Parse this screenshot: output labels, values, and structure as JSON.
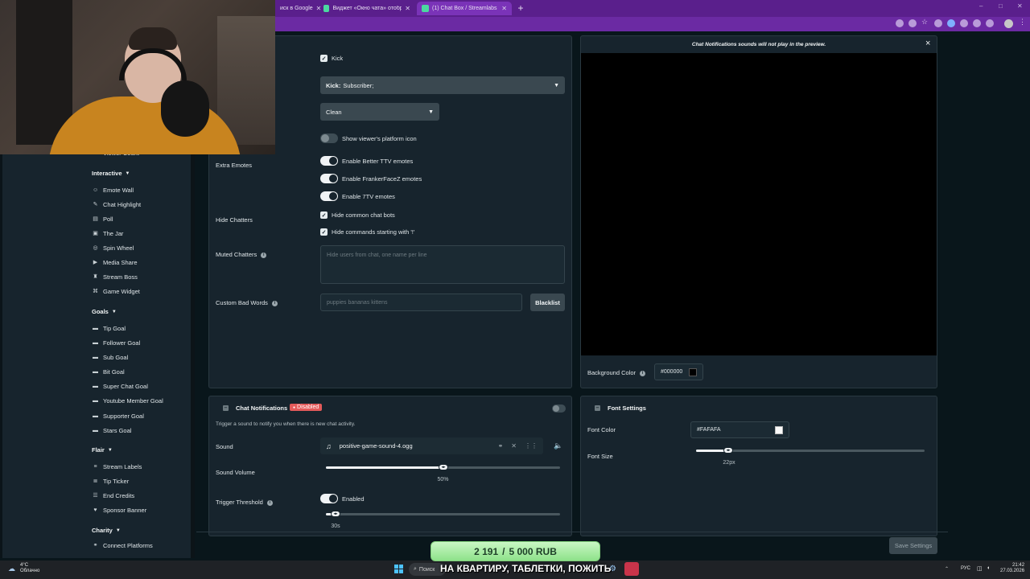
{
  "browser": {
    "tabs": [
      {
        "label": "иск в Google"
      },
      {
        "label": "Виджет «Окно чата» отображае"
      },
      {
        "label": "(1) Chat Box / Streamlabs"
      }
    ],
    "new_tab": "+",
    "window_controls": [
      "–",
      "□",
      "✕"
    ]
  },
  "sidebar": {
    "cut_label": "Viewer Count",
    "sections": [
      {
        "title": "Interactive",
        "items": [
          {
            "label": "Emote Wall",
            "icon": "emote-icon"
          },
          {
            "label": "Chat Highlight",
            "icon": "pencil-icon"
          },
          {
            "label": "Poll",
            "icon": "poll-icon"
          },
          {
            "label": "The Jar",
            "icon": "jar-icon"
          },
          {
            "label": "Spin Wheel",
            "icon": "wheel-icon"
          },
          {
            "label": "Media Share",
            "icon": "media-icon"
          },
          {
            "label": "Stream Boss",
            "icon": "boss-icon"
          },
          {
            "label": "Game Widget",
            "icon": "gamepad-icon"
          }
        ]
      },
      {
        "title": "Goals",
        "items": [
          {
            "label": "Tip Goal",
            "icon": "goal-icon"
          },
          {
            "label": "Follower Goal",
            "icon": "goal-icon"
          },
          {
            "label": "Sub Goal",
            "icon": "goal-icon"
          },
          {
            "label": "Bit Goal",
            "icon": "goal-icon"
          },
          {
            "label": "Super Chat Goal",
            "icon": "goal-icon"
          },
          {
            "label": "Youtube Member Goal",
            "icon": "goal-icon"
          },
          {
            "label": "Supporter Goal",
            "icon": "goal-icon"
          },
          {
            "label": "Stars Goal",
            "icon": "goal-icon"
          }
        ]
      },
      {
        "title": "Flair",
        "items": [
          {
            "label": "Stream Labels",
            "icon": "labels-icon"
          },
          {
            "label": "Tip Ticker",
            "icon": "ticker-icon"
          },
          {
            "label": "End Credits",
            "icon": "credits-icon"
          },
          {
            "label": "Sponsor Banner",
            "icon": "heart-icon"
          }
        ]
      },
      {
        "title": "Charity",
        "items": [
          {
            "label": "Connect Platforms",
            "icon": "link-icon"
          }
        ]
      }
    ]
  },
  "settings": {
    "kick_checkbox": "Kick",
    "platform_select": {
      "bold": "Kick:",
      "value": "Subscriber;"
    },
    "theme_select": "Clean",
    "show_platform_icon": "Show viewer's platform icon",
    "extra_emotes_label": "Extra Emotes",
    "emotes": [
      "Enable Better TTV emotes",
      "Enable FrankerFaceZ emotes",
      "Enable 7TV emotes"
    ],
    "hide_chatters_label": "Hide Chatters",
    "hide_options": [
      "Hide common chat bots",
      "Hide commands starting with '!'"
    ],
    "muted_label": "Muted Chatters",
    "muted_placeholder": "Hide users from chat, one name per line",
    "bad_words_label": "Custom Bad Words",
    "bad_words_placeholder": "puppies bananas kittens",
    "blacklist_button": "Blacklist"
  },
  "preview": {
    "notice": "Chat Notifications sounds will not play in the preview.",
    "close": "×",
    "bg_label": "Background Color",
    "bg_value": "#000000",
    "bg_swatch": "#000000"
  },
  "notifications": {
    "title": "Chat Notifications",
    "badge": "Disabled",
    "description": "Trigger a sound to notify you when there is new chat activity.",
    "sound_label": "Sound",
    "sound_file": "positive-game-sound-4.ogg",
    "volume_label": "Sound Volume",
    "volume_value": "50%",
    "volume_level": 0.5,
    "threshold_label": "Trigger Threshold",
    "threshold_toggle": "Enabled",
    "threshold_value": "30s",
    "threshold_level": 0.04
  },
  "font": {
    "title": "Font Settings",
    "color_label": "Font Color",
    "color_value": "#FAFAFA",
    "color_swatch": "#FAFAFA",
    "size_label": "Font Size",
    "size_value": "22px",
    "size_level": 0.14
  },
  "save_button": "Save Settings",
  "overlay": {
    "donation_current": "2 191",
    "donation_sep": "/",
    "donation_goal": "5 000 RUB",
    "subtitle": "НА КВАРТИРУ, ТАБЛЕТКИ, ПОЖИТЬ"
  },
  "taskbar": {
    "weather_temp": "4°C",
    "weather_desc": "Облачно",
    "search": "Поиск",
    "lang": "РУС",
    "time": "21:42",
    "date": "27.03.2026"
  }
}
